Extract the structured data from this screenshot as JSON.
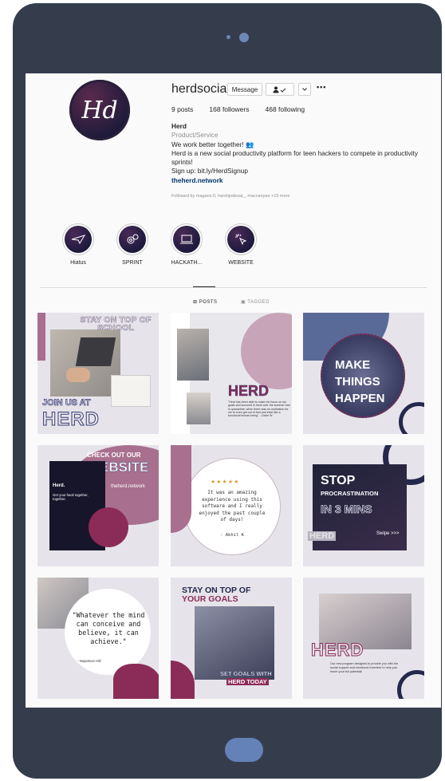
{
  "profile": {
    "username": "herdsocial",
    "avatar_text": "Hd",
    "message_label": "Message",
    "follow_icon": "person-check-icon",
    "dropdown_icon": "chevron-down-icon",
    "more_label": "•••",
    "posts": "9 posts",
    "followers": "168 followers",
    "following": "468 following",
    "name": "Herd",
    "category": "Product/Service",
    "bio_line1": "We work better together! 👥",
    "bio_line2": "Herd is a new social productivity platform for teen hackers to compete in productivity sprints!",
    "bio_line3": "Sign up: bit.ly/HerdSignup",
    "link": "theherd.network",
    "followed_by": "Followed by magans.0, harshjodesai_, maccanyao +15 more"
  },
  "highlights": [
    {
      "label": "Hiatus",
      "icon": "paper-plane-icon"
    },
    {
      "label": "SPRINT",
      "icon": "gears-icon"
    },
    {
      "label": "HACKATH...",
      "icon": "laptop-icon"
    },
    {
      "label": "WEBSITE",
      "icon": "cursor-click-icon"
    }
  ],
  "tabs": {
    "posts": "POSTS",
    "tagged": "TAGGED"
  },
  "posts": {
    "p1": {
      "title": "STAY ON TOP OF SCHOOL",
      "footer_a": "JOIN US AT",
      "footer_b": "HERD"
    },
    "p2": {
      "title": "HERD",
      "quote": "\"Herd has been able to make me focus on my goals and succeed in them over the summer and in quarantine, when there was no motivation for me to even get out of bed and exist like a functional human being\" - Claire W."
    },
    "p3": {
      "line1": "MAKE",
      "line2": "THINGS",
      "line3": "HAPPEN"
    },
    "p4": {
      "line1": "CHECK OUT OUR",
      "line2": "WEBSITE",
      "url": "theherd.network",
      "screen_title": "Herd.",
      "screen_sub": "Get your hack together, together."
    },
    "p5": {
      "stars": "★★★★★",
      "quote": "It was an amazing experience using this software and I really enjoyed the past couple of days!",
      "author": "- Akhil K"
    },
    "p6": {
      "line1": "STOP",
      "line2": "PROCRASTINATION",
      "line3": "IN 3 MINS",
      "brand": "HERD",
      "swipe": "Swipe >>>"
    },
    "p7": {
      "quote": "\"Whatever the mind can conceive and believe, it can achieve.\"",
      "author": "- Napoleon Hill"
    },
    "p8": {
      "title1": "STAY ON TOP OF",
      "title2": "YOUR GOALS",
      "footer1": "SET GOALS WITH",
      "footer2": "HERD TODAY"
    },
    "p9": {
      "brand": "HERD",
      "text": "Our new program designed to provide you with the social support and emotional incentive to help you reach your full potential!"
    }
  },
  "colors": {
    "frame": "#353d4d",
    "accent": "#8b2c58",
    "mauve": "#a8708e",
    "navy": "#24284d"
  }
}
